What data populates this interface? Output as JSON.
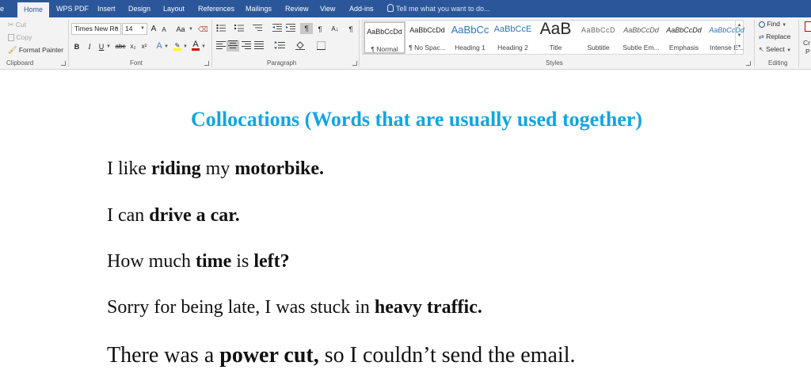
{
  "tabs": [
    "e",
    "Home",
    "WPS PDF",
    "Insert",
    "Design",
    "Layout",
    "References",
    "Mailings",
    "Review",
    "View",
    "Add-ins"
  ],
  "tell_me": "Tell me what you want to do...",
  "clipboard": {
    "cut": "Cut",
    "copy": "Copy",
    "format_painter": "Format Painter",
    "label": "Clipboard"
  },
  "font": {
    "family": "Times New Ro",
    "size": "14",
    "grow": "A",
    "shrink": "A",
    "case": "Aa",
    "bold": "B",
    "italic": "I",
    "underline": "U",
    "strike": "abc",
    "subscript": "x₂",
    "superscript": "x²",
    "text_effects": "A",
    "font_color": "A",
    "label": "Font"
  },
  "paragraph": {
    "pilcrow": "¶",
    "label": "Paragraph"
  },
  "styles": {
    "items": [
      {
        "sample": "AaBbCcDd",
        "name": "¶ Normal"
      },
      {
        "sample": "AaBbCcDd",
        "name": "¶ No Spac..."
      },
      {
        "sample": "AaBbCc",
        "name": "Heading 1"
      },
      {
        "sample": "AaBbCcE",
        "name": "Heading 2"
      },
      {
        "sample": "AaB",
        "name": "Title"
      },
      {
        "sample": "AaBbCcD",
        "name": "Subtitle"
      },
      {
        "sample": "AaBbCcDd",
        "name": "Subtle Em..."
      },
      {
        "sample": "AaBbCcDd",
        "name": "Emphasis"
      },
      {
        "sample": "AaBbCcDd",
        "name": "Intense E..."
      }
    ],
    "label": "Styles"
  },
  "editing": {
    "find": "Find",
    "replace": "Replace",
    "select": "Select",
    "label": "Editing",
    "cut_off_1": "Cr",
    "cut_off_2": "P"
  },
  "document": {
    "title": "Collocations (Words that are usually used together)",
    "lines": [
      [
        {
          "t": "I like ",
          "b": false
        },
        {
          "t": "riding",
          "b": true
        },
        {
          "t": " my ",
          "b": false
        },
        {
          "t": "motorbike.",
          "b": true
        }
      ],
      [
        {
          "t": "I can ",
          "b": false
        },
        {
          "t": "drive a car.",
          "b": true
        }
      ],
      [
        {
          "t": "How much ",
          "b": false
        },
        {
          "t": "time",
          "b": true
        },
        {
          "t": " is ",
          "b": false
        },
        {
          "t": "left?",
          "b": true
        }
      ],
      [
        {
          "t": "Sorry for being late, I was stuck in ",
          "b": false
        },
        {
          "t": "heavy traffic.",
          "b": true
        }
      ],
      [
        {
          "t": "There was a ",
          "b": false
        },
        {
          "t": "power cut,",
          "b": true
        },
        {
          "t": " so I couldn’t send the email.",
          "b": false
        }
      ]
    ]
  },
  "colors": {
    "ribbon_blue": "#2b579a",
    "title_blue": "#14a4e0"
  }
}
